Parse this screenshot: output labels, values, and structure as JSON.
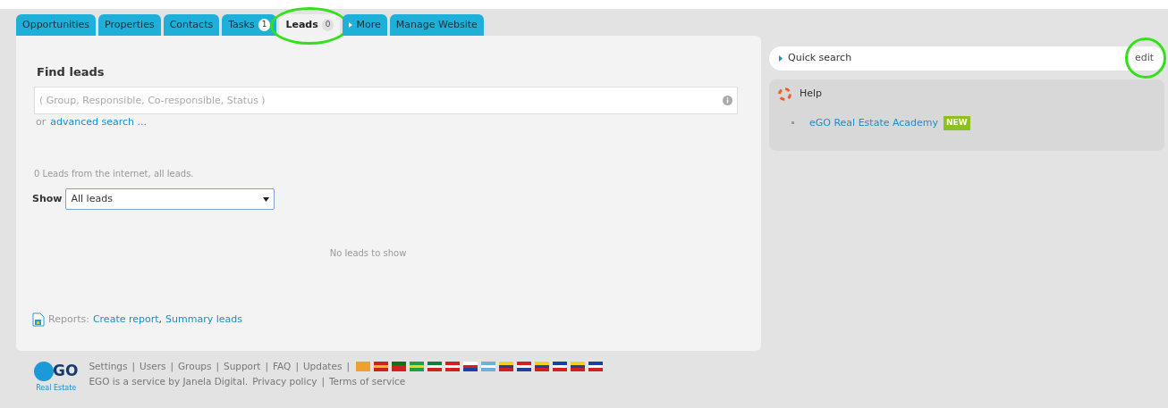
{
  "tabs": [
    {
      "label": "Opportunities",
      "menu": false,
      "selected": false,
      "highlighted": false
    },
    {
      "label": "Properties",
      "menu": false,
      "selected": false,
      "highlighted": false
    },
    {
      "label": "Contacts",
      "menu": false,
      "selected": false,
      "highlighted": false
    },
    {
      "label": "Tasks",
      "badge": "1",
      "menu": false,
      "selected": false,
      "highlighted": false
    },
    {
      "label": "Leads",
      "badge": "0",
      "menu": false,
      "selected": true,
      "highlighted": true
    },
    {
      "label": "More",
      "menu": true,
      "selected": false,
      "highlighted": false
    },
    {
      "label": "Manage Website",
      "menu": false,
      "selected": false,
      "highlighted": false
    }
  ],
  "find": {
    "title": "Find leads",
    "placeholder": "( Group, Responsible, Co-responsible, Status )",
    "or": "or",
    "advanced_link": "advanced search ..."
  },
  "summary": "0 Leads from the internet, all leads.",
  "show": {
    "label": "Show",
    "value": "All leads"
  },
  "empty_message": "No leads to show",
  "reports": {
    "label": "Reports:",
    "links": [
      "Create report",
      "Summary leads"
    ],
    "separator": ","
  },
  "quick_search": {
    "label": "Quick search",
    "edit": "edit",
    "edit_highlighted": true
  },
  "help": {
    "title": "Help",
    "items": [
      {
        "label": "eGO Real Estate Academy",
        "badge": "NEW"
      }
    ]
  },
  "footer": {
    "logo": "GO",
    "logo_sub": "Real Estate",
    "links": [
      "Settings",
      "Users",
      "Groups",
      "Support",
      "FAQ",
      "Updates"
    ],
    "separator": "|",
    "service": "EGO is a service by Janela Digital.",
    "legal_links": [
      "Privacy policy",
      "Terms of service"
    ]
  }
}
